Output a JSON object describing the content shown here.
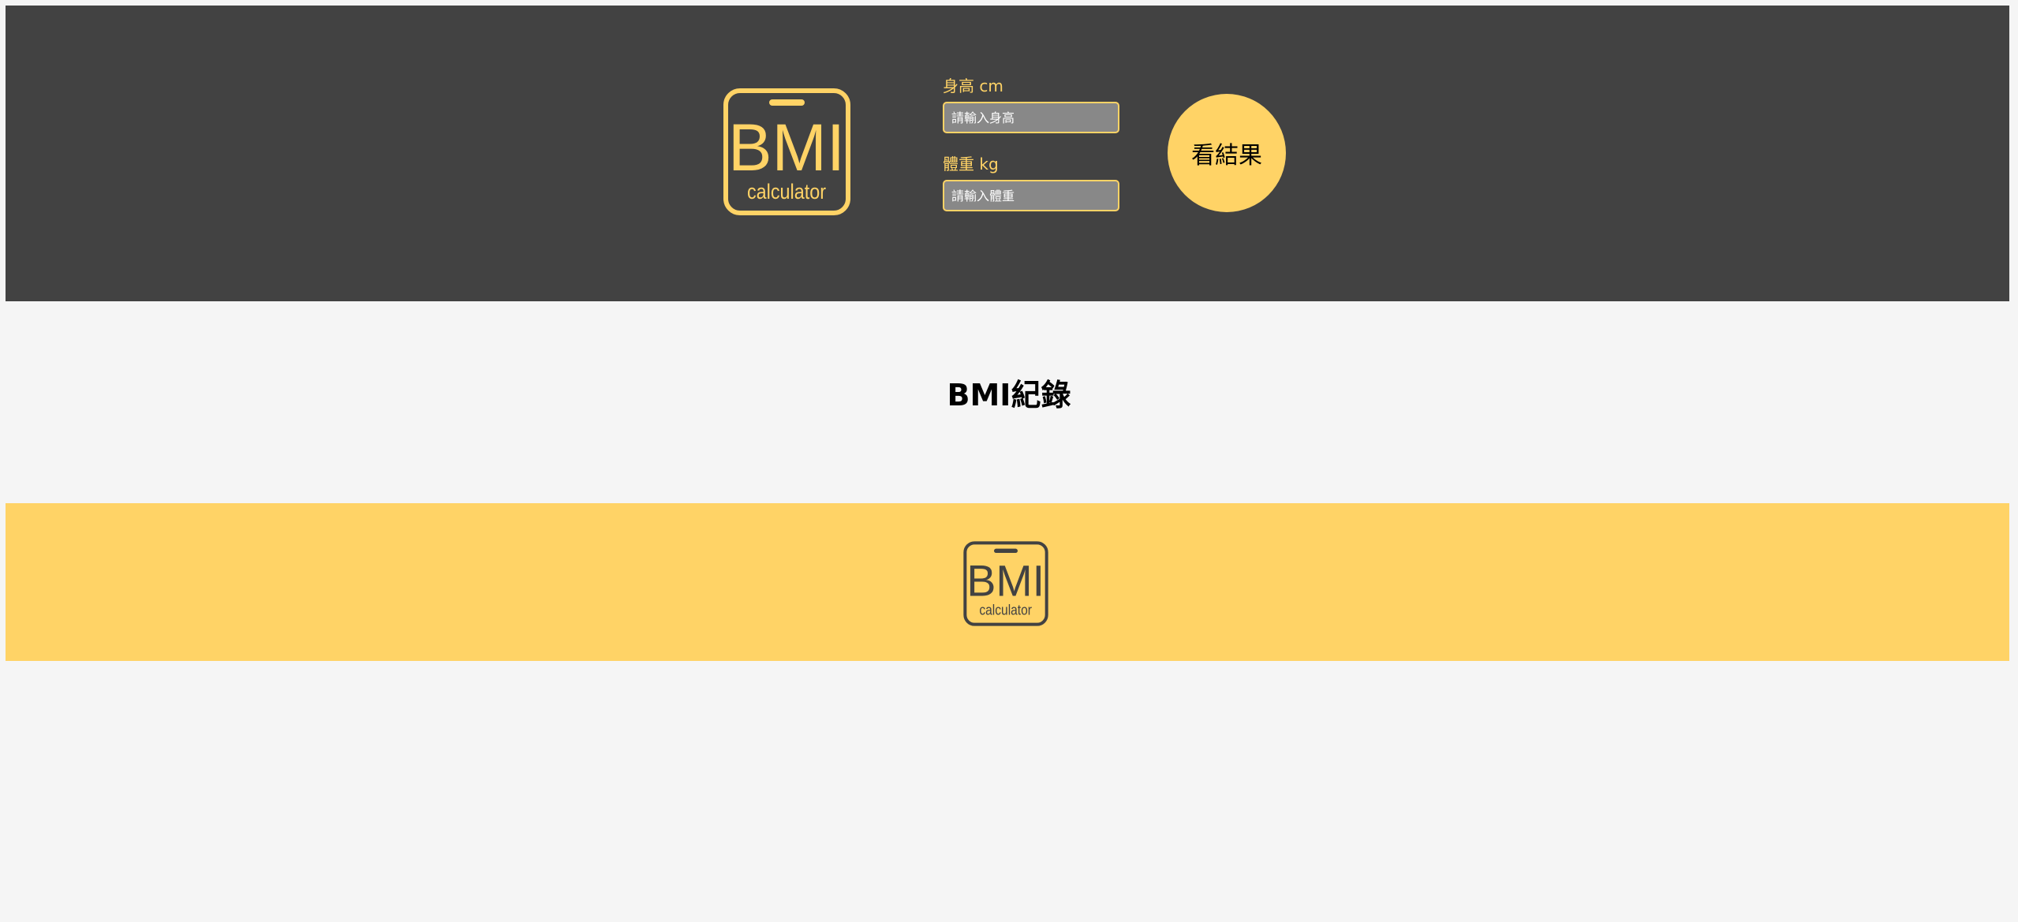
{
  "colors": {
    "header_background": "#424242",
    "accent": "#ffd366",
    "input_background": "#888888",
    "page_background": "#f5f5f5"
  },
  "logo": {
    "main_text": "BMI",
    "sub_text": "calculator"
  },
  "form": {
    "height": {
      "label": "身高 cm",
      "placeholder": "請輸入身高"
    },
    "weight": {
      "label": "體重 kg",
      "placeholder": "請輸入體重"
    },
    "submit_label": "看結果"
  },
  "records": {
    "title": "BMI紀錄"
  }
}
